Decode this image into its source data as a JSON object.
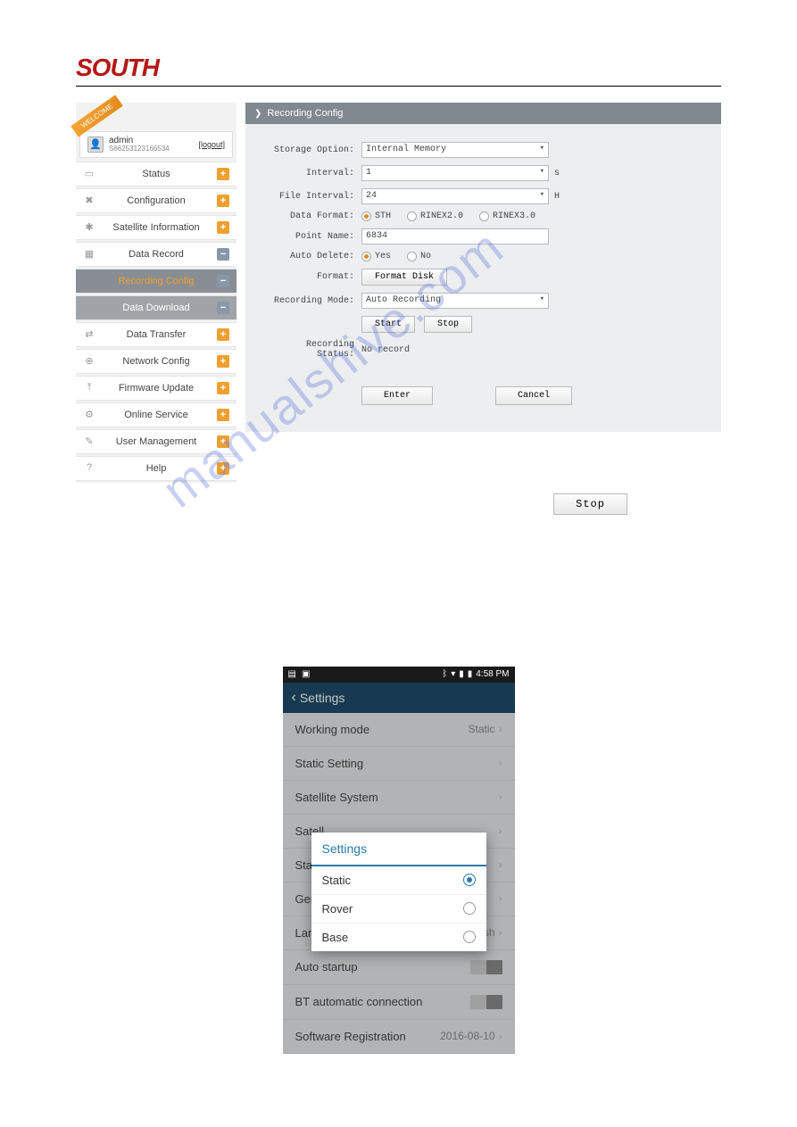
{
  "brand": "SOUTH",
  "watermark": "manualshive.com",
  "user": {
    "name": "admin",
    "id": "S66253123166534",
    "logout": "[logout]"
  },
  "welcome": "WELCOME",
  "sidebar": [
    {
      "label": "Status",
      "badge": "+",
      "icon": "▭"
    },
    {
      "label": "Configuration",
      "badge": "+",
      "icon": "✖"
    },
    {
      "label": "Satellite Information",
      "badge": "+",
      "icon": "✱"
    },
    {
      "label": "Data Record",
      "badge": "−",
      "icon": "▦"
    },
    {
      "label": "Recording Config",
      "badge": "−",
      "sub": true,
      "active": true
    },
    {
      "label": "Data Download",
      "badge": "−",
      "sub": true
    },
    {
      "label": "Data Transfer",
      "badge": "+",
      "icon": "⇄"
    },
    {
      "label": "Network Config",
      "badge": "+",
      "icon": "⊕"
    },
    {
      "label": "Firmware Update",
      "badge": "+",
      "icon": "⤒"
    },
    {
      "label": "Online Service",
      "badge": "+",
      "icon": "⚙"
    },
    {
      "label": "User Management",
      "badge": "+",
      "icon": "✎"
    },
    {
      "label": "Help",
      "badge": "+",
      "icon": "?"
    }
  ],
  "panel": {
    "title": "Recording Config",
    "storage_option": {
      "label": "Storage Option:",
      "value": "Internal Memory"
    },
    "interval": {
      "label": "Interval:",
      "value": "1",
      "unit": "s"
    },
    "file_interval": {
      "label": "File Interval:",
      "value": "24",
      "unit": "H"
    },
    "data_format": {
      "label": "Data Format:",
      "options": [
        "STH",
        "RINEX2.0",
        "RINEX3.0"
      ],
      "selected": "STH"
    },
    "point_name": {
      "label": "Point Name:",
      "value": "6834"
    },
    "auto_delete": {
      "label": "Auto Delete:",
      "options": [
        "Yes",
        "No"
      ],
      "selected": "Yes"
    },
    "format": {
      "label": "Format:",
      "button": "Format Disk"
    },
    "recording_mode": {
      "label": "Recording Mode:",
      "value": "Auto Recording"
    },
    "start": "Start",
    "stop": "Stop",
    "recording_status": {
      "label": "Recording Status:",
      "value": "No record"
    },
    "enter": "Enter",
    "cancel": "Cancel"
  },
  "standalone_stop": "Stop",
  "phone": {
    "time": "4:58 PM",
    "title": "Settings",
    "rows": {
      "working_mode": {
        "label": "Working mode",
        "value": "Static"
      },
      "static_setting": {
        "label": "Static Setting"
      },
      "satellite_system": {
        "label": "Satellite System"
      },
      "satell": {
        "label": "Satell"
      },
      "statu": {
        "label": "Statu"
      },
      "gene": {
        "label": "Gene"
      },
      "language": {
        "label": "Language",
        "value": "English"
      },
      "auto_startup": {
        "label": "Auto startup"
      },
      "bt_auto": {
        "label": "BT automatic connection"
      },
      "software_reg": {
        "label": "Software Registration",
        "value": "2016-08-10"
      }
    },
    "dialog": {
      "title": "Settings",
      "opts": [
        "Static",
        "Rover",
        "Base"
      ],
      "selected": "Static"
    }
  }
}
